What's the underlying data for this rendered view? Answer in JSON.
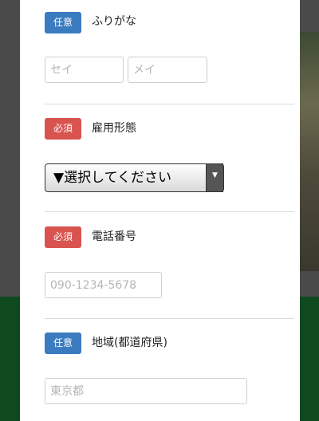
{
  "form": {
    "furigana": {
      "badge": "任意",
      "label": "ふりがな",
      "sei_placeholder": "セイ",
      "mei_placeholder": "メイ"
    },
    "employment": {
      "badge": "必須",
      "label": "雇用形態",
      "select_value": "▼選択してください",
      "arrow": "▼"
    },
    "phone": {
      "badge": "必須",
      "label": "電話番号",
      "placeholder": "090-1234-5678"
    },
    "region": {
      "badge": "任意",
      "label": "地域(都道府県)",
      "placeholder": "東京都"
    }
  },
  "colors": {
    "optional_badge": "#3b7bbf",
    "required_badge": "#d9534f"
  }
}
